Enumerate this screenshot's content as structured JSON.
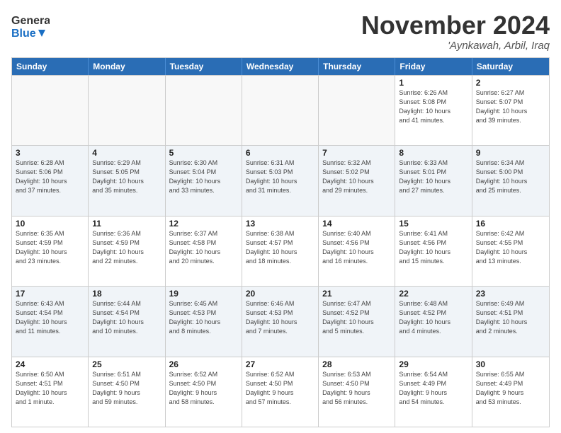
{
  "header": {
    "logo_general": "General",
    "logo_blue": "Blue",
    "month_title": "November 2024",
    "location": "'Aynkawah, Arbil, Iraq"
  },
  "calendar": {
    "days_of_week": [
      "Sunday",
      "Monday",
      "Tuesday",
      "Wednesday",
      "Thursday",
      "Friday",
      "Saturday"
    ],
    "rows": [
      [
        {
          "day": "",
          "info": "",
          "empty": true
        },
        {
          "day": "",
          "info": "",
          "empty": true
        },
        {
          "day": "",
          "info": "",
          "empty": true
        },
        {
          "day": "",
          "info": "",
          "empty": true
        },
        {
          "day": "",
          "info": "",
          "empty": true
        },
        {
          "day": "1",
          "info": "Sunrise: 6:26 AM\nSunset: 5:08 PM\nDaylight: 10 hours\nand 41 minutes."
        },
        {
          "day": "2",
          "info": "Sunrise: 6:27 AM\nSunset: 5:07 PM\nDaylight: 10 hours\nand 39 minutes."
        }
      ],
      [
        {
          "day": "3",
          "info": "Sunrise: 6:28 AM\nSunset: 5:06 PM\nDaylight: 10 hours\nand 37 minutes."
        },
        {
          "day": "4",
          "info": "Sunrise: 6:29 AM\nSunset: 5:05 PM\nDaylight: 10 hours\nand 35 minutes."
        },
        {
          "day": "5",
          "info": "Sunrise: 6:30 AM\nSunset: 5:04 PM\nDaylight: 10 hours\nand 33 minutes."
        },
        {
          "day": "6",
          "info": "Sunrise: 6:31 AM\nSunset: 5:03 PM\nDaylight: 10 hours\nand 31 minutes."
        },
        {
          "day": "7",
          "info": "Sunrise: 6:32 AM\nSunset: 5:02 PM\nDaylight: 10 hours\nand 29 minutes."
        },
        {
          "day": "8",
          "info": "Sunrise: 6:33 AM\nSunset: 5:01 PM\nDaylight: 10 hours\nand 27 minutes."
        },
        {
          "day": "9",
          "info": "Sunrise: 6:34 AM\nSunset: 5:00 PM\nDaylight: 10 hours\nand 25 minutes."
        }
      ],
      [
        {
          "day": "10",
          "info": "Sunrise: 6:35 AM\nSunset: 4:59 PM\nDaylight: 10 hours\nand 23 minutes."
        },
        {
          "day": "11",
          "info": "Sunrise: 6:36 AM\nSunset: 4:59 PM\nDaylight: 10 hours\nand 22 minutes."
        },
        {
          "day": "12",
          "info": "Sunrise: 6:37 AM\nSunset: 4:58 PM\nDaylight: 10 hours\nand 20 minutes."
        },
        {
          "day": "13",
          "info": "Sunrise: 6:38 AM\nSunset: 4:57 PM\nDaylight: 10 hours\nand 18 minutes."
        },
        {
          "day": "14",
          "info": "Sunrise: 6:40 AM\nSunset: 4:56 PM\nDaylight: 10 hours\nand 16 minutes."
        },
        {
          "day": "15",
          "info": "Sunrise: 6:41 AM\nSunset: 4:56 PM\nDaylight: 10 hours\nand 15 minutes."
        },
        {
          "day": "16",
          "info": "Sunrise: 6:42 AM\nSunset: 4:55 PM\nDaylight: 10 hours\nand 13 minutes."
        }
      ],
      [
        {
          "day": "17",
          "info": "Sunrise: 6:43 AM\nSunset: 4:54 PM\nDaylight: 10 hours\nand 11 minutes."
        },
        {
          "day": "18",
          "info": "Sunrise: 6:44 AM\nSunset: 4:54 PM\nDaylight: 10 hours\nand 10 minutes."
        },
        {
          "day": "19",
          "info": "Sunrise: 6:45 AM\nSunset: 4:53 PM\nDaylight: 10 hours\nand 8 minutes."
        },
        {
          "day": "20",
          "info": "Sunrise: 6:46 AM\nSunset: 4:53 PM\nDaylight: 10 hours\nand 7 minutes."
        },
        {
          "day": "21",
          "info": "Sunrise: 6:47 AM\nSunset: 4:52 PM\nDaylight: 10 hours\nand 5 minutes."
        },
        {
          "day": "22",
          "info": "Sunrise: 6:48 AM\nSunset: 4:52 PM\nDaylight: 10 hours\nand 4 minutes."
        },
        {
          "day": "23",
          "info": "Sunrise: 6:49 AM\nSunset: 4:51 PM\nDaylight: 10 hours\nand 2 minutes."
        }
      ],
      [
        {
          "day": "24",
          "info": "Sunrise: 6:50 AM\nSunset: 4:51 PM\nDaylight: 10 hours\nand 1 minute."
        },
        {
          "day": "25",
          "info": "Sunrise: 6:51 AM\nSunset: 4:50 PM\nDaylight: 9 hours\nand 59 minutes."
        },
        {
          "day": "26",
          "info": "Sunrise: 6:52 AM\nSunset: 4:50 PM\nDaylight: 9 hours\nand 58 minutes."
        },
        {
          "day": "27",
          "info": "Sunrise: 6:52 AM\nSunset: 4:50 PM\nDaylight: 9 hours\nand 57 minutes."
        },
        {
          "day": "28",
          "info": "Sunrise: 6:53 AM\nSunset: 4:50 PM\nDaylight: 9 hours\nand 56 minutes."
        },
        {
          "day": "29",
          "info": "Sunrise: 6:54 AM\nSunset: 4:49 PM\nDaylight: 9 hours\nand 54 minutes."
        },
        {
          "day": "30",
          "info": "Sunrise: 6:55 AM\nSunset: 4:49 PM\nDaylight: 9 hours\nand 53 minutes."
        }
      ]
    ]
  }
}
